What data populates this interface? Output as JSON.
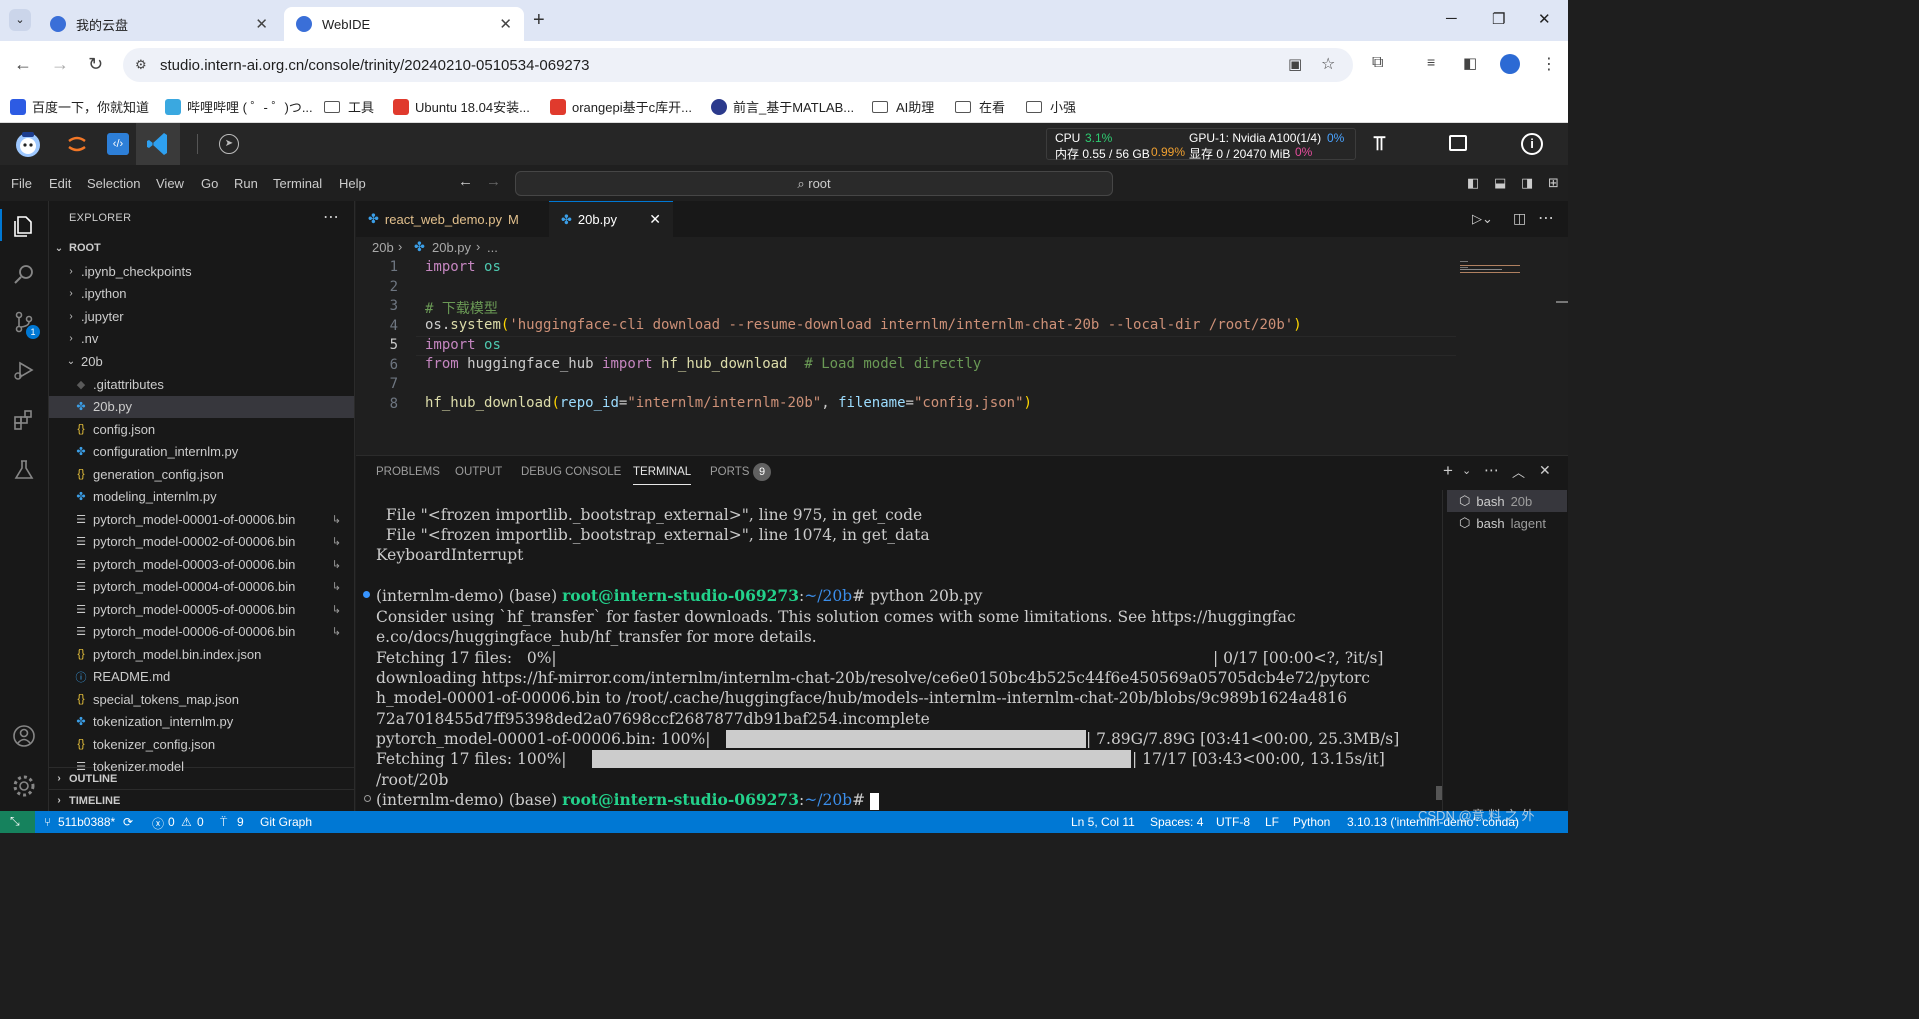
{
  "browser": {
    "tabs": [
      {
        "title": "我的云盘"
      },
      {
        "title": "WebIDE"
      }
    ],
    "url": "studio.intern-ai.org.cn/console/trinity/20240210-0510534-069273",
    "bookmarks": [
      "百度一下，你就知道",
      "哔哩哔哩 ( ゜- ゜)つ...",
      "工具",
      "Ubuntu 18.04安装...",
      "orangepi基于c库开...",
      "前言_基于MATLAB...",
      "AI助理",
      "在看",
      "小强"
    ]
  },
  "studio": {
    "cpu_label": "CPU",
    "cpu_value": "3.1%",
    "mem_label": "内存 0.55 / 56 GB",
    "mem_value": "0.99%",
    "gpu_label": "GPU-1: Nvidia A100(1/4)",
    "gpu_value": "0%",
    "vram_label": "显存 0 / 20470 MiB",
    "vram_value": "0%"
  },
  "menubar": {
    "items": [
      "File",
      "Edit",
      "Selection",
      "View",
      "Go",
      "Run",
      "Terminal",
      "Help"
    ],
    "search": "root"
  },
  "activity": {
    "scm_badge": "1"
  },
  "sidebar": {
    "title": "EXPLORER",
    "root": "ROOT",
    "folders": [
      ".ipynb_checkpoints",
      ".ipython",
      ".jupyter",
      ".nv"
    ],
    "open_folder": "20b",
    "files": [
      {
        "name": ".gitattributes",
        "type": "git"
      },
      {
        "name": "20b.py",
        "type": "py"
      },
      {
        "name": "config.json",
        "type": "json"
      },
      {
        "name": "configuration_internlm.py",
        "type": "py"
      },
      {
        "name": "generation_config.json",
        "type": "json"
      },
      {
        "name": "modeling_internlm.py",
        "type": "py"
      },
      {
        "name": "pytorch_model-00001-of-00006.bin",
        "type": "bin"
      },
      {
        "name": "pytorch_model-00002-of-00006.bin",
        "type": "bin"
      },
      {
        "name": "pytorch_model-00003-of-00006.bin",
        "type": "bin"
      },
      {
        "name": "pytorch_model-00004-of-00006.bin",
        "type": "bin"
      },
      {
        "name": "pytorch_model-00005-of-00006.bin",
        "type": "bin"
      },
      {
        "name": "pytorch_model-00006-of-00006.bin",
        "type": "bin"
      },
      {
        "name": "pytorch_model.bin.index.json",
        "type": "json"
      },
      {
        "name": "README.md",
        "type": "md"
      },
      {
        "name": "special_tokens_map.json",
        "type": "json"
      },
      {
        "name": "tokenization_internlm.py",
        "type": "py"
      },
      {
        "name": "tokenizer_config.json",
        "type": "json"
      },
      {
        "name": "tokenizer.model",
        "type": "bin"
      }
    ],
    "outline": "OUTLINE",
    "timeline": "TIMELINE"
  },
  "editor": {
    "tabs": [
      {
        "label": "react_web_demo.py",
        "status": "M"
      },
      {
        "label": "20b.py"
      }
    ],
    "breadcrumb": {
      "folder": "20b",
      "file": "20b.py",
      "tail": "..."
    },
    "line_numbers": [
      "1",
      "2",
      "3",
      "4",
      "5",
      "6",
      "7",
      "8"
    ],
    "code": {
      "l1_kw": "import",
      "l1_mod": "os",
      "l3_comment": "# 下载模型",
      "l4_pre": "os.",
      "l4_fn": "system",
      "l4_open": "(",
      "l4_str": "'huggingface-cli download --resume-download internlm/internlm-chat-20b --local-dir /root/20b'",
      "l4_close": ")",
      "l5_kw": "import",
      "l5_mod": "os",
      "l6_from": "from",
      "l6_mod": "huggingface_hub",
      "l6_import": "import",
      "l6_fn": "hf_hub_download",
      "l6_comment": "# Load model directly",
      "l8_fn": "hf_hub_download",
      "l8_open": "(",
      "l8_p1": "repo_id",
      "l8_eq1": "=",
      "l8_s1": "\"internlm/internlm-20b\"",
      "l8_comma": ", ",
      "l8_p2": "filename",
      "l8_eq2": "=",
      "l8_s2": "\"config.json\"",
      "l8_close": ")"
    }
  },
  "panel": {
    "tabs": [
      "PROBLEMS",
      "OUTPUT",
      "DEBUG CONSOLE",
      "TERMINAL",
      "PORTS"
    ],
    "ports_badge": "9",
    "terminals": [
      {
        "name": "bash",
        "detail": "20b"
      },
      {
        "name": "bash",
        "detail": "lagent"
      }
    ]
  },
  "terminal": {
    "l1": "  File \"<frozen importlib._bootstrap_external>\", line 975, in get_code",
    "l2": "  File \"<frozen importlib._bootstrap_external>\", line 1074, in get_data",
    "l3": "KeyboardInterrupt",
    "p1_env": "(internlm-demo) (base) ",
    "p1_user": "root@intern-studio-069273",
    "p1_colon": ":",
    "p1_path": "~/20b",
    "p1_cmd": "# python 20b.py",
    "l5": "Consider using `hf_transfer` for faster downloads. This solution comes with some limitations. See https://huggingfac",
    "l6": "e.co/docs/huggingface_hub/hf_transfer for more details.",
    "l7a": "Fetching 17 files:   0%|",
    "l7b": "| 0/17 [00:00<?, ?it/s]",
    "l8": "downloading https://hf-mirror.com/internlm/internlm-chat-20b/resolve/ce6e0150bc4b525c44f6e450569a05705dcb4e72/pytorc",
    "l9": "h_model-00001-of-00006.bin to /root/.cache/huggingface/hub/models--internlm--internlm-chat-20b/blobs/9c989b1624a4816",
    "l10": "72a7018455d7ff95398ded2a07698ccf2687877db91baf254.incomplete",
    "l11a": "pytorch_model-00001-of-00006.bin: 100%|",
    "l11b": "| 7.89G/7.89G [03:41<00:00, 25.3MB/s]",
    "l12a": "Fetching 17 files: 100%|",
    "l12b": "| 17/17 [03:43<00:00, 13.15s/it]",
    "l13": "/root/20b",
    "p2_env": "(internlm-demo) (base) ",
    "p2_user": "root@intern-studio-069273",
    "p2_colon": ":",
    "p2_path": "~/20b",
    "p2_hash": "# "
  },
  "statusbar": {
    "branch": "511b0388*",
    "errors": "0",
    "warnings": "0",
    "ports": "9",
    "git_graph": "Git Graph",
    "position": "Ln 5, Col 11",
    "spaces": "Spaces: 4",
    "encoding": "UTF-8",
    "eol": "LF",
    "language": "Python",
    "interpreter": "3.10.13 ('internlm-demo': conda)",
    "watermark": "CSDN @意 料 之 外"
  },
  "colors": {
    "accent": "#0078d4",
    "status_bg": "#0078d4",
    "prompt_user": "#23d18b",
    "prompt_path": "#3b8eea"
  }
}
